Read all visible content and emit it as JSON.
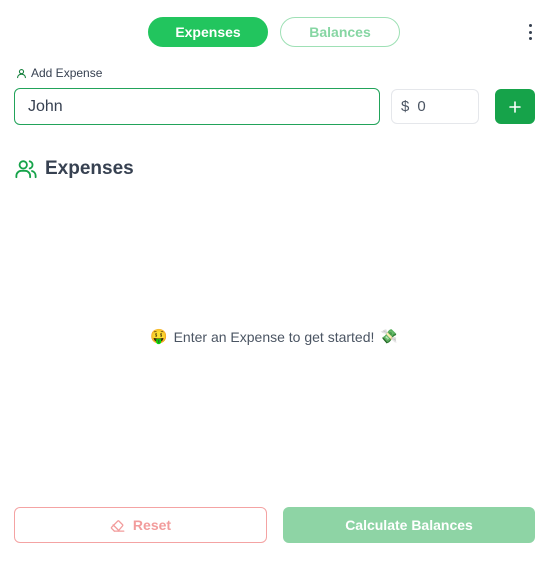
{
  "tabs": [
    {
      "label": "Expenses",
      "active": true
    },
    {
      "label": "Balances",
      "active": false
    }
  ],
  "form": {
    "label": "Add Expense",
    "name_value": "John",
    "currency": "$",
    "amount_value": "0",
    "add_icon": "plus-icon"
  },
  "expenses": {
    "title": "Expenses",
    "empty_emoji_left": "🤑",
    "empty_message": "Enter an Expense to get started!",
    "empty_emoji_right": "💸"
  },
  "actions": {
    "reset_label": "Reset",
    "calculate_label": "Calculate Balances"
  },
  "colors": {
    "primary": "#22c55e",
    "primary_dark": "#16a34a",
    "danger_light": "#f4a3a3"
  }
}
